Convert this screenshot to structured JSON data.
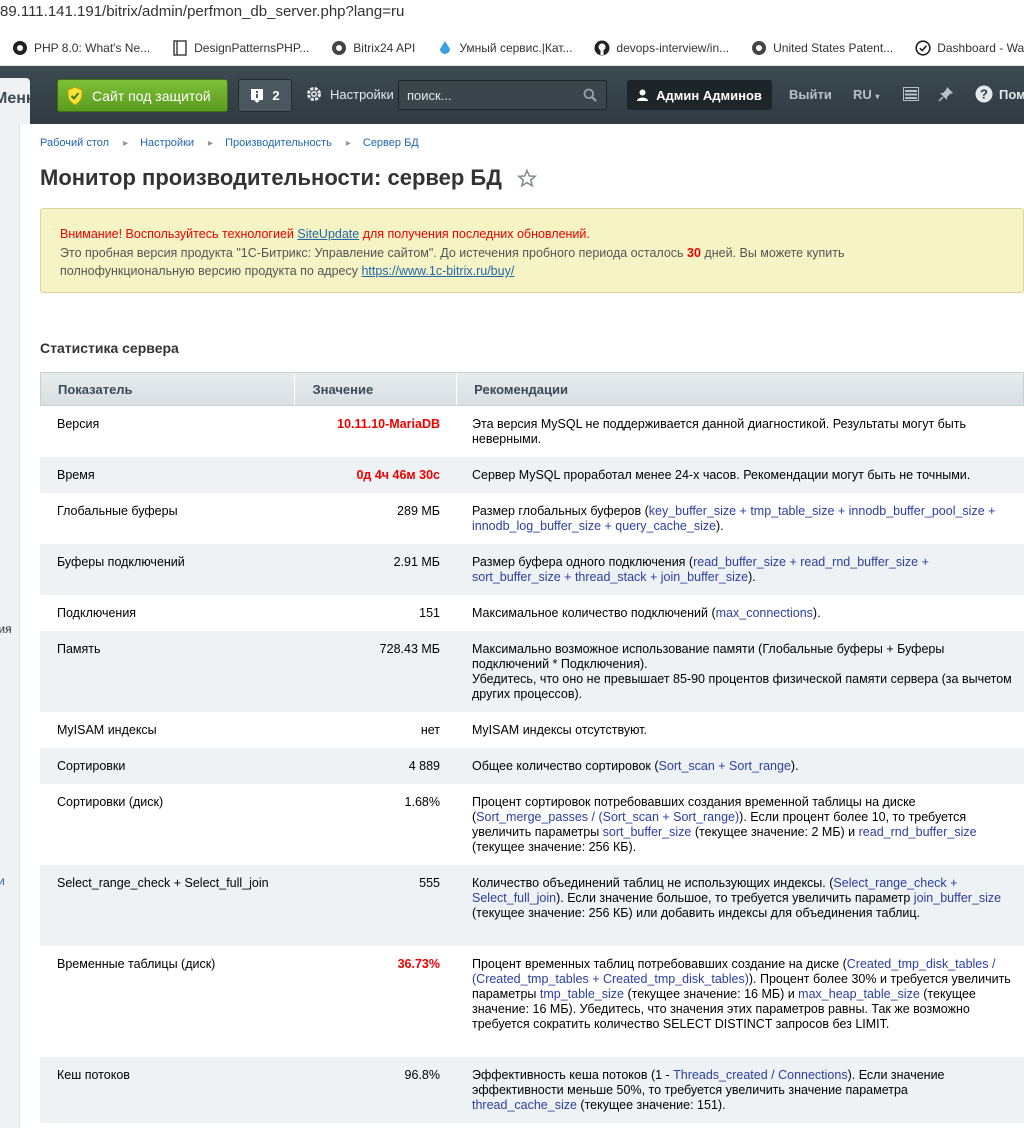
{
  "browser": {
    "url": "89.111.141.191/bitrix/admin/perfmon_db_server.php?lang=ru",
    "bookmarks": [
      {
        "label": "PHP 8.0: What's Ne...",
        "icon": "php-icon"
      },
      {
        "label": "DesignPatternsPHP...",
        "icon": "book-icon"
      },
      {
        "label": "Bitrix24 API",
        "icon": "globe-icon"
      },
      {
        "label": "Умный сервис.|Кат...",
        "icon": "drop-icon"
      },
      {
        "label": "devops-interview/in...",
        "icon": "github-icon"
      },
      {
        "label": "United States Patent...",
        "icon": "globe-icon"
      },
      {
        "label": "Dashboard - WakaT...",
        "icon": "check-circle-icon"
      }
    ]
  },
  "adminbar": {
    "menu_label": "Меню",
    "protect_label": "Сайт под защитой",
    "notifications_count": "2",
    "settings_label": "Настройки",
    "search_placeholder": "поиск...",
    "user_name": "Админ Админов",
    "logout_label": "Выйти",
    "lang_label": "RU",
    "help_label": "Помощь",
    "colors": {
      "bar": "#3e4a52",
      "protect": "#6aad28"
    }
  },
  "leftstrip": {
    "fragment1": "гия",
    "fragment2": "и"
  },
  "breadcrumbs": [
    "Рабочий стол",
    "Настройки",
    "Производительность",
    "Сервер БД"
  ],
  "page_title": "Монитор производительности: сервер БД",
  "warning": {
    "line1_prefix": "Внимание! Воспользуйтесь технологией ",
    "line1_link": "SiteUpdate",
    "line1_suffix": " для получения последних обновлений.",
    "line2_prefix": "Это пробная версия продукта \"1С-Битрикс: Управление сайтом\". До истечения пробного периода осталось ",
    "line2_days": "30",
    "line2_suffix": " дней. Вы можете купить",
    "line3_prefix": "полнофункциональную версию продукта по адресу ",
    "line3_link": "https://www.1c-bitrix.ru/buy/"
  },
  "section_title": "Статистика сервера",
  "table": {
    "headers": [
      "Показатель",
      "Значение",
      "Рекомендации"
    ],
    "rows": [
      {
        "name": "Версия",
        "value": "10.11.10-MariaDB",
        "bad": true,
        "rec": "Эта версия MySQL не поддерживается данной диагностикой. Результаты могут быть неверными.",
        "h": 51
      },
      {
        "name": "Время",
        "value": "0д 4ч 46м 30с",
        "bad": true,
        "rec": "Сервер MySQL проработал менее 24-х часов. Рекомендации могут быть не точными.",
        "h": 36
      },
      {
        "name": "Глобальные буферы",
        "value": "289 МБ",
        "bad": false,
        "rec_html": "Размер глобальных буферов (<span class=\"hl\">key_buffer_size + tmp_table_size + innodb_buffer_pool_size + innodb_log_buffer_size + query_cache_size</span>).",
        "h": 51
      },
      {
        "name": "Буферы подключений",
        "value": "2.91 МБ",
        "bad": false,
        "rec_html": "Размер буфера одного подключения (<span class=\"hl\">read_buffer_size + read_rnd_buffer_size + sort_buffer_size + thread_stack + join_buffer_size</span>).",
        "h": 51
      },
      {
        "name": "Подключения",
        "value": "151",
        "bad": false,
        "rec_html": "Максимальное количество подключений (<span class=\"hl\">max_connections</span>).",
        "h": 36
      },
      {
        "name": "Память",
        "value": "728.43 МБ",
        "bad": false,
        "rec": "Максимально возможное использование памяти (Глобальные буферы + Буферы подключений * Подключения).\nУбедитесь, что оно не превышает 85-90 процентов физической памяти сервера (за вычетом других процессов).",
        "h": 81
      },
      {
        "name": "MyISAM индексы",
        "value": "нет",
        "bad": false,
        "rec": "MyISAM индексы отсутствуют.",
        "h": 36
      },
      {
        "name": "Сортировки",
        "value": "4 889",
        "bad": false,
        "rec_html": "Общее количество сортировок (<span class=\"hl\">Sort_scan + Sort_range</span>).",
        "h": 36
      },
      {
        "name": "Сортировки (диск)",
        "value": "1.68%",
        "bad": false,
        "rec_html": "Процент сортировок потребовавших создания временной таблицы на диске (<span class=\"hl\">Sort_merge_passes / (Sort_scan + Sort_range)</span>). Если процент более 10, то требуется увеличить параметры <span class=\"hl\">sort_buffer_size</span> (текущее значение: 2 МБ) и <span class=\"hl\">read_rnd_buffer_size</span> (текущее значение: 256 КБ).",
        "h": 81
      },
      {
        "name": "Select_range_check + Select_full_join",
        "value": "555",
        "bad": false,
        "rec_html": "Количество объединений таблиц не использующих индексы. (<span class=\"hl\">Select_range_check + Select_full_join</span>). Если значение большое, то требуется увеличить параметр <span class=\"hl\">join_buffer_size</span> (текущее значение: 256 КБ) или добавить индексы для объединения таблиц.",
        "h": 81
      },
      {
        "name": "Временные таблицы (диск)",
        "value": "36.73%",
        "bad": true,
        "rec_html": "Процент временных таблиц потребовавших создание на диске (<span class=\"hl\">Created_tmp_disk_tables / (Created_tmp_tables + Created_tmp_disk_tables)</span>). Процент более 30% и требуется увеличить параметры <span class=\"hl\">tmp_table_size</span> (текущее значение: 16 МБ) и <span class=\"hl\">max_heap_table_size</span> (текущее значение: 16 МБ). Убедитесь, что значения этих параметров равны. Так же возможно требуется сократить количество SELECT DISTINCT запросов без LIMIT.",
        "h": 111
      },
      {
        "name": "Кеш потоков",
        "value": "96.8%",
        "bad": false,
        "rec_html": "Эффективность кеша потоков (1 - <span class=\"hl\">Threads_created / Connections</span>). Если значение эффективности меньше 50%, то требуется увеличить значение параметра <span class=\"hl\">thread_cache_size</span> (текущее значение: 151).",
        "h": 66
      }
    ]
  }
}
